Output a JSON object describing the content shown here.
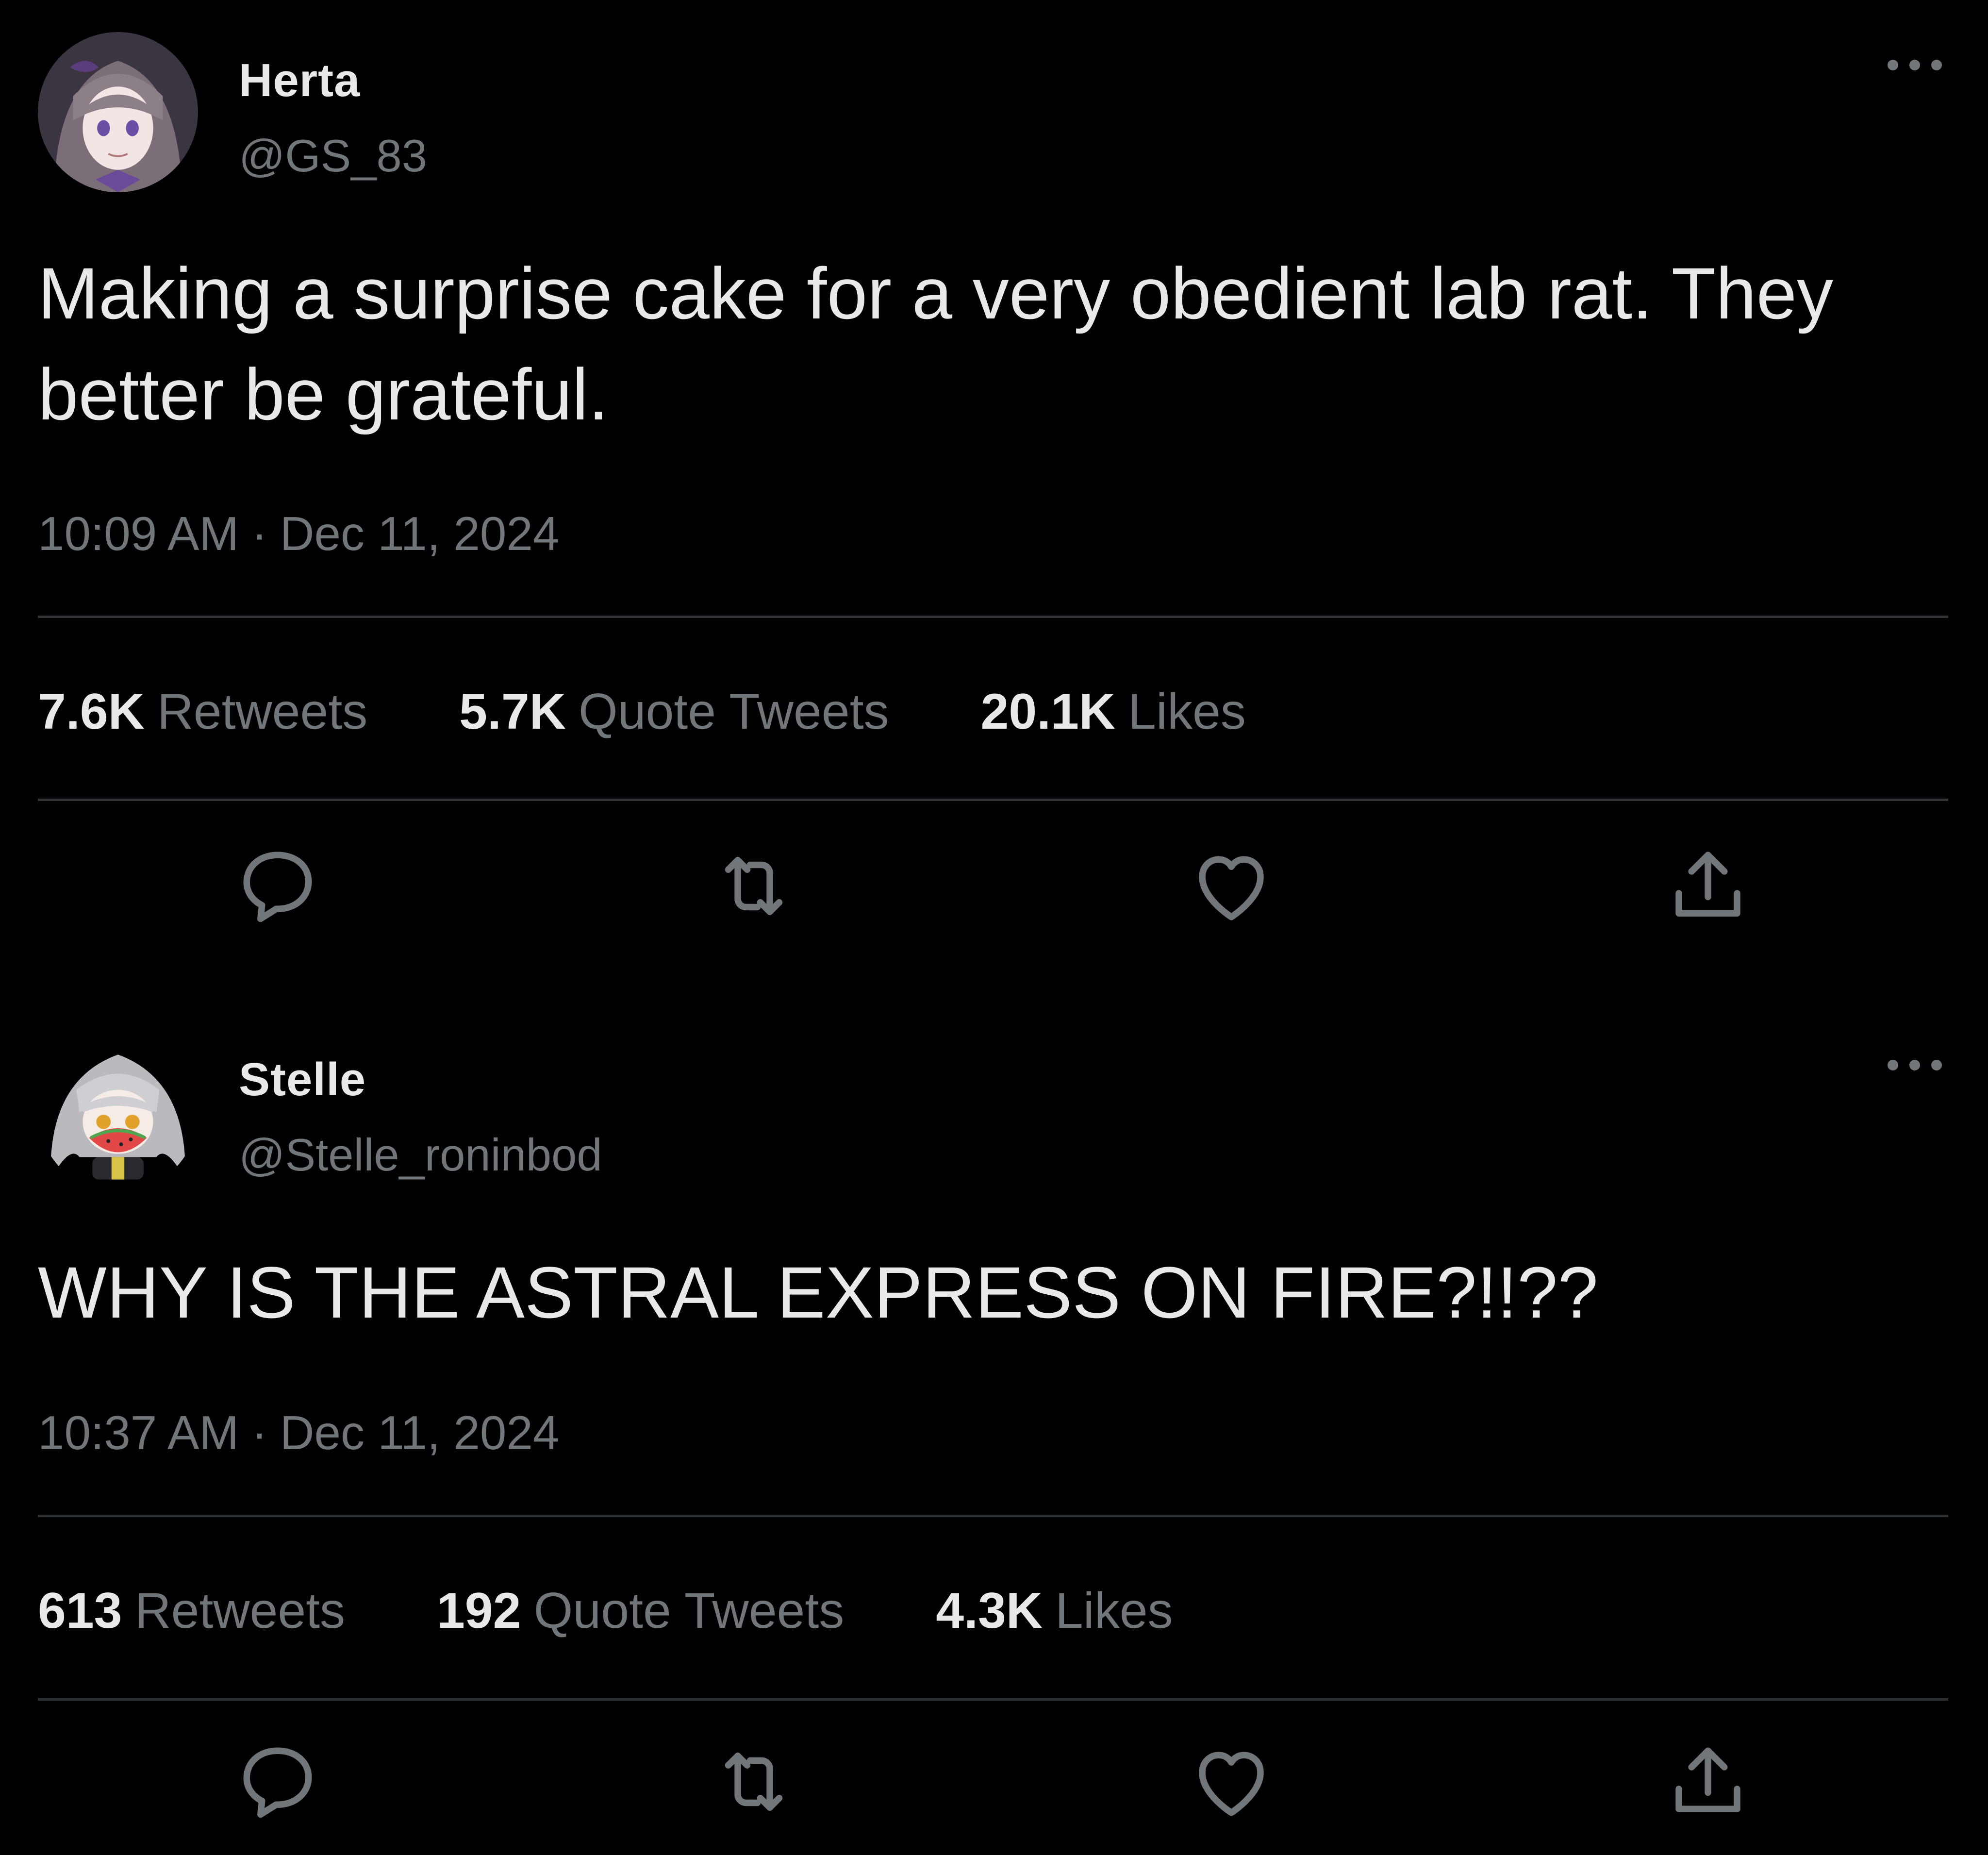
{
  "tweets": [
    {
      "author_name": "Herta",
      "handle": "@GS_83",
      "avatar": "herta-avatar",
      "text": "Making a surprise cake for a very obedient lab rat. They better be grateful.",
      "time": "10:09 AM",
      "separator": "·",
      "date": "Dec 11, 2024",
      "stats": [
        {
          "value": "7.6K",
          "label": "Retweets"
        },
        {
          "value": "5.7K",
          "label": "Quote Tweets"
        },
        {
          "value": "20.1K",
          "label": "Likes"
        }
      ],
      "actions": [
        "reply-icon",
        "retweet-icon",
        "like-icon",
        "share-icon"
      ]
    },
    {
      "author_name": "Stelle",
      "handle": "@Stelle_roninbod",
      "avatar": "stelle-avatar",
      "text": "WHY IS THE ASTRAL EXPRESS ON FIRE?!!??",
      "time": "10:37 AM",
      "separator": "·",
      "date": "Dec 11, 2024",
      "stats": [
        {
          "value": "613",
          "label": "Retweets"
        },
        {
          "value": "192",
          "label": "Quote Tweets"
        },
        {
          "value": "4.3K",
          "label": "Likes"
        }
      ],
      "actions": [
        "reply-icon",
        "retweet-icon",
        "like-icon",
        "share-icon"
      ]
    }
  ],
  "colors": {
    "background": "#000000",
    "primary_text": "#e7e9ea",
    "secondary_text": "#71767b",
    "divider": "#2f3336"
  }
}
